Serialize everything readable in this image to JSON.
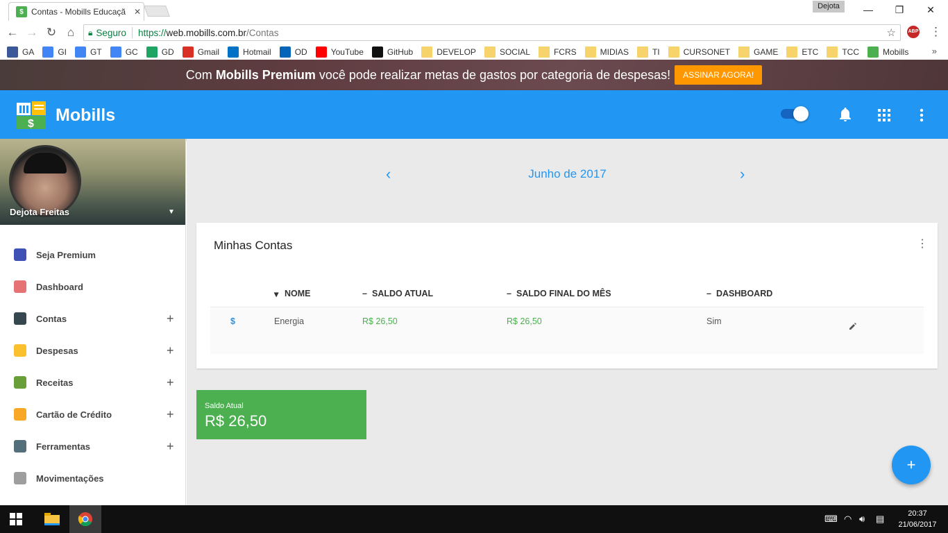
{
  "browser": {
    "tab_title": "Contas - Mobills Educaçã",
    "tab_close": "✕",
    "user_badge": "Dejota",
    "win_minimize": "—",
    "win_restore": "❐",
    "win_close": "✕",
    "secure_label": "Seguro",
    "url_scheme": "https://",
    "url_host": "web.mobills.com.br",
    "url_path": "/Contas",
    "abp_label": "ABP",
    "bookmarks": [
      {
        "label": "GA",
        "color": "#3b5998"
      },
      {
        "label": "GI",
        "color": "#4285f4"
      },
      {
        "label": "GT",
        "color": "#4285f4"
      },
      {
        "label": "GC",
        "color": "#4285f4"
      },
      {
        "label": "GD",
        "color": "#1fa463"
      },
      {
        "label": "Gmail",
        "color": "#d93025"
      },
      {
        "label": "Hotmail",
        "color": "#0072c6"
      },
      {
        "label": "OD",
        "color": "#0364b8"
      },
      {
        "label": "YouTube",
        "color": "#ff0000"
      },
      {
        "label": "GitHub",
        "color": "#111111"
      },
      {
        "label": "DEVELOP",
        "color": "folder"
      },
      {
        "label": "SOCIAL",
        "color": "folder"
      },
      {
        "label": "FCRS",
        "color": "folder"
      },
      {
        "label": "MIDIAS",
        "color": "folder"
      },
      {
        "label": "TI",
        "color": "folder"
      },
      {
        "label": "CURSONET",
        "color": "folder"
      },
      {
        "label": "GAME",
        "color": "folder"
      },
      {
        "label": "ETC",
        "color": "folder"
      },
      {
        "label": "TCC",
        "color": "folder"
      },
      {
        "label": "Mobills",
        "color": "#4caf50"
      }
    ],
    "bookmarks_more": "»"
  },
  "banner": {
    "text_before": "Com ",
    "text_bold": "Mobills Premium",
    "text_after": " você pode realizar metas de gastos por categoria de despesas!",
    "cta": "ASSINAR AGORA!"
  },
  "app": {
    "brand": "Mobills",
    "colors": {
      "primary": "#2196f3",
      "green": "#4caf50",
      "orange": "#ff9800"
    }
  },
  "profile": {
    "name": "Dejota Freitas"
  },
  "sidebar": {
    "items": [
      {
        "label": "Seja Premium",
        "icon": "crown-icon",
        "color": "#3f51b5",
        "expandable": false
      },
      {
        "label": "Dashboard",
        "icon": "home-icon",
        "color": "#e57373",
        "expandable": false
      },
      {
        "label": "Contas",
        "icon": "wallet-icon",
        "color": "#37474f",
        "expandable": true
      },
      {
        "label": "Despesas",
        "icon": "coins-icon",
        "color": "#fbc02d",
        "expandable": true
      },
      {
        "label": "Receitas",
        "icon": "money-icon",
        "color": "#689f38",
        "expandable": true
      },
      {
        "label": "Cartão de Crédito",
        "icon": "credit-card-icon",
        "color": "#f9a825",
        "expandable": true
      },
      {
        "label": "Ferramentas",
        "icon": "tools-icon",
        "color": "#546e7a",
        "expandable": true
      },
      {
        "label": "Movimentações",
        "icon": "list-icon",
        "color": "#9e9e9e",
        "expandable": false
      }
    ],
    "plus": "+"
  },
  "main": {
    "month": "Junho de 2017",
    "prev": "‹",
    "next": "›",
    "card_title": "Minhas Contas",
    "table": {
      "headers": [
        "NOME",
        "SALDO ATUAL",
        "SALDO FINAL DO MÊS",
        "DASHBOARD"
      ],
      "rows": [
        {
          "icon": "$",
          "nome": "Energia",
          "saldo_atual": "R$ 26,50",
          "saldo_final": "R$ 26,50",
          "dashboard": "Sim"
        }
      ]
    },
    "saldo_label": "Saldo Atual",
    "saldo_value": "R$ 26,50",
    "fab": "+"
  },
  "taskbar": {
    "time": "20:37",
    "date": "21/06/2017"
  }
}
